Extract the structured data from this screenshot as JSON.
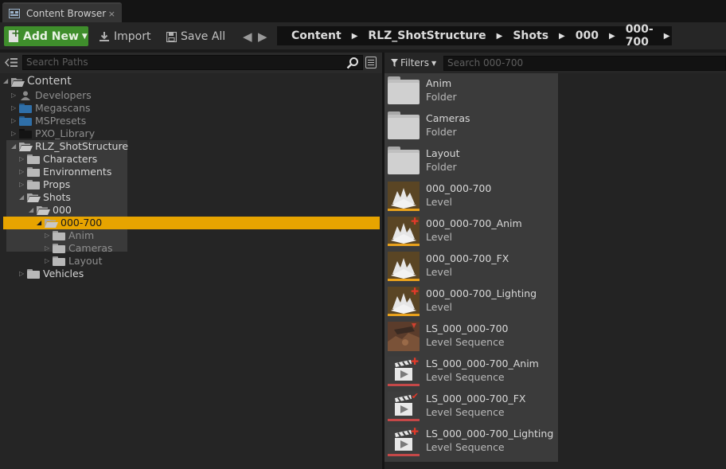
{
  "tab": {
    "title": "Content Browser",
    "close": "×"
  },
  "toolbar": {
    "add_new": "Add New",
    "import": "Import",
    "save_all": "Save All"
  },
  "breadcrumb": [
    "Content",
    "RLZ_ShotStructure",
    "Shots",
    "000",
    "000-700"
  ],
  "paths": {
    "search_placeholder": "Search Paths",
    "tree": [
      {
        "label": "Content",
        "depth": 0,
        "expanded": true,
        "kind": "root"
      },
      {
        "label": "Developers",
        "depth": 1,
        "kind": "developers"
      },
      {
        "label": "Megascans",
        "depth": 1,
        "kind": "blue"
      },
      {
        "label": "MSPresets",
        "depth": 1,
        "kind": "blue"
      },
      {
        "label": "PXO_Library",
        "depth": 1,
        "kind": "dark"
      },
      {
        "label": "RLZ_ShotStructure",
        "depth": 1,
        "expanded": true,
        "kind": "open"
      },
      {
        "label": "Characters",
        "depth": 2,
        "kind": "grey"
      },
      {
        "label": "Environments",
        "depth": 2,
        "kind": "grey"
      },
      {
        "label": "Props",
        "depth": 2,
        "kind": "grey"
      },
      {
        "label": "Shots",
        "depth": 2,
        "expanded": true,
        "kind": "open"
      },
      {
        "label": "000",
        "depth": 3,
        "expanded": true,
        "kind": "open"
      },
      {
        "label": "000-700",
        "depth": 4,
        "expanded": true,
        "kind": "open",
        "selected": true
      },
      {
        "label": "Anim",
        "depth": 5,
        "kind": "grey"
      },
      {
        "label": "Cameras",
        "depth": 5,
        "kind": "grey"
      },
      {
        "label": "Layout",
        "depth": 5,
        "kind": "grey"
      },
      {
        "label": "Vehicles",
        "depth": 2,
        "kind": "grey"
      }
    ]
  },
  "assets": {
    "filters_label": "Filters",
    "search_placeholder": "Search 000-700",
    "items": [
      {
        "name": "Anim",
        "type": "Folder",
        "thumb": "folder"
      },
      {
        "name": "Cameras",
        "type": "Folder",
        "thumb": "folder"
      },
      {
        "name": "Layout",
        "type": "Folder",
        "thumb": "folder"
      },
      {
        "name": "000_000-700",
        "type": "Level",
        "thumb": "level"
      },
      {
        "name": "000_000-700_Anim",
        "type": "Level",
        "thumb": "level-plus"
      },
      {
        "name": "000_000-700_FX",
        "type": "Level",
        "thumb": "level"
      },
      {
        "name": "000_000-700_Lighting",
        "type": "Level",
        "thumb": "level-plus"
      },
      {
        "name": "LS_000_000-700",
        "type": "Level Sequence",
        "thumb": "seq-image"
      },
      {
        "name": "LS_000_000-700_Anim",
        "type": "Level Sequence",
        "thumb": "seq-plus"
      },
      {
        "name": "LS_000_000-700_FX",
        "type": "Level Sequence",
        "thumb": "seq-check"
      },
      {
        "name": "LS_000_000-700_Lighting",
        "type": "Level Sequence",
        "thumb": "seq-plus"
      }
    ]
  },
  "colors": {
    "addnew_green": "#3f8e2c",
    "selection_orange": "#e7a400",
    "level_bar": "#e8a11c",
    "sequence_bar": "#c54848",
    "blue_folder": "#2f6fa8"
  }
}
